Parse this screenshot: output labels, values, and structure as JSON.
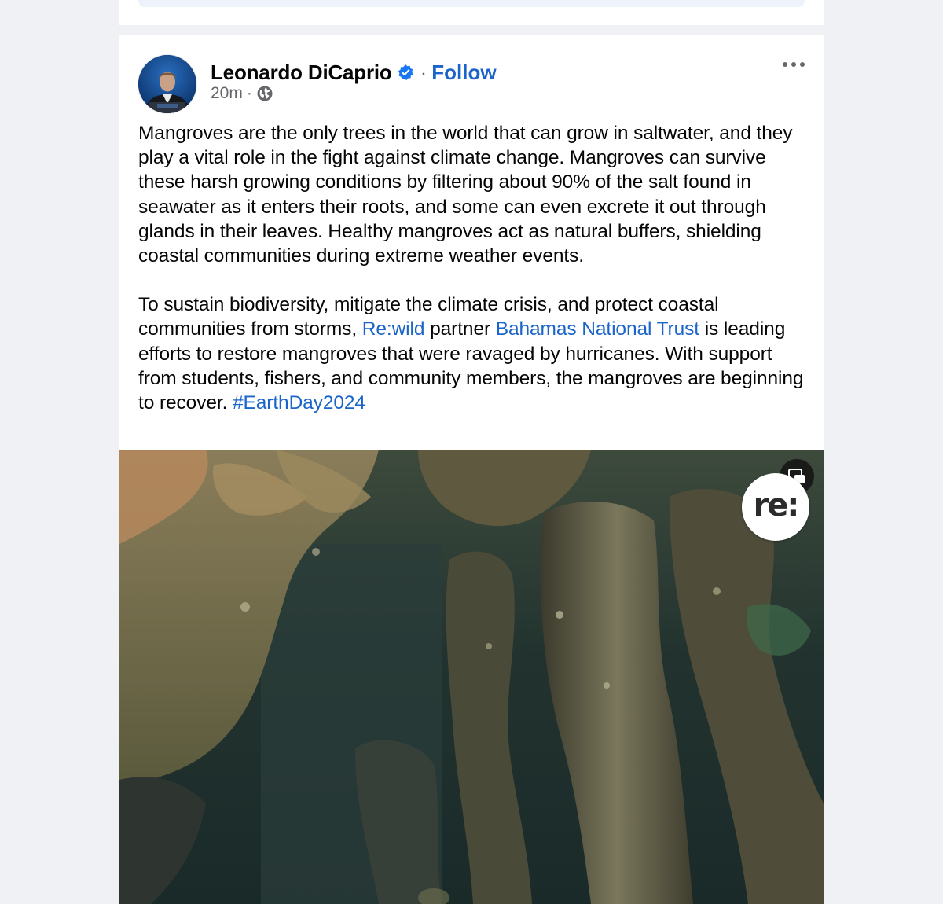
{
  "post": {
    "author": "Leonardo DiCaprio",
    "separator": "·",
    "follow_label": "Follow",
    "time": "20m",
    "meta_separator": "·",
    "paragraph1": "Mangroves are the only trees in the world that can grow in saltwater, and they play a vital role in the fight against climate change. Mangroves can survive these harsh growing conditions by filtering about 90% of the salt found in seawater as it enters their roots, and some can even excrete it out through glands in their leaves. Healthy mangroves act as natural buffers, shielding coastal communities during extreme weather events.",
    "p2_text1": "To sustain biodiversity, mitigate the climate crisis, and protect coastal communities from storms, ",
    "p2_link1": "Re:wild",
    "p2_text2": " partner ",
    "p2_link2": "Bahamas National Trust",
    "p2_text3": " is leading efforts to restore mangroves that were ravaged by hurricanes. With support from students, fishers, and community members, the mangroves are beginning to recover. ",
    "p2_hashtag": "#EarthDay2024"
  },
  "media": {
    "logo_text": "re:",
    "pip_icon": "picture-in-picture-icon"
  },
  "icons": {
    "verified": "verified-badge-icon",
    "privacy": "globe-icon",
    "more": "more-horizontal-icon"
  },
  "colors": {
    "link": "#1b64c9",
    "verified": "#1877f2",
    "meta": "#65676b",
    "background": "#f0f1f4"
  }
}
